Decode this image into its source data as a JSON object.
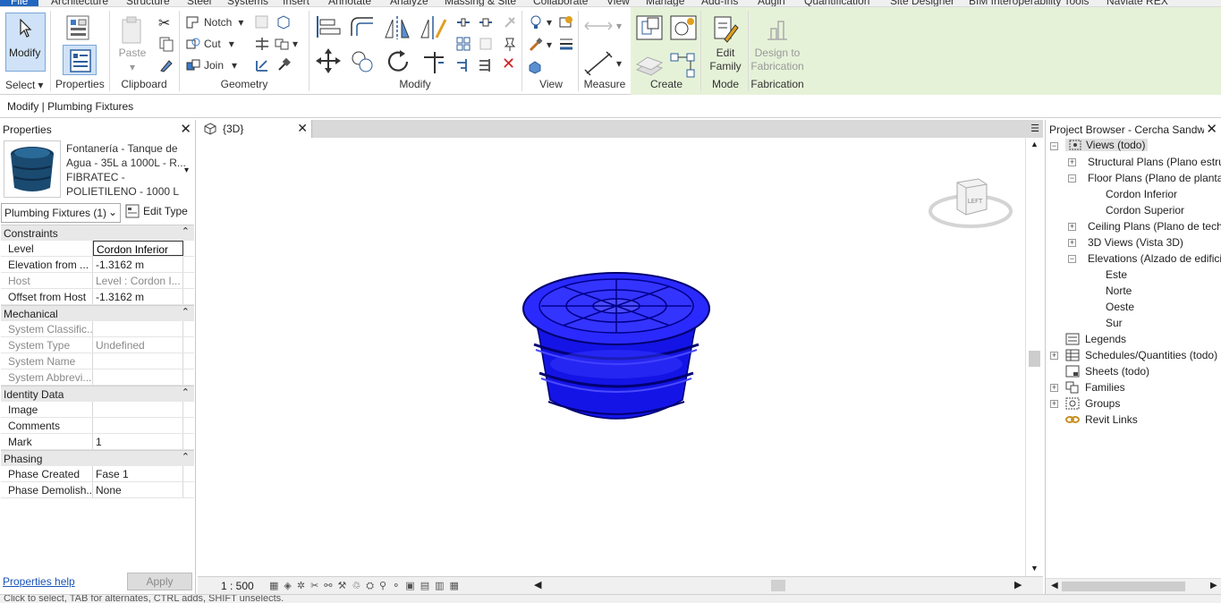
{
  "menu_tabs": [
    "File",
    "Architecture",
    "Structure",
    "Steel",
    "Systems",
    "Insert",
    "Annotate",
    "Analyze",
    "Massing & Site",
    "Collaborate",
    "View",
    "Manage",
    "Add-Ins",
    "Augin",
    "Quantification",
    "Site Designer",
    "BIM Interoperability Tools",
    "Naviate REX"
  ],
  "ribbon": {
    "modify_label": "Modify",
    "select_label": "Select",
    "properties_label": "Properties",
    "paste_label": "Paste",
    "clipboard_label": "Clipboard",
    "notch_label": "Notch",
    "cut_label": "Cut",
    "join_label": "Join",
    "geometry_label": "Geometry",
    "modify_group_label": "Modify",
    "view_label": "View",
    "measure_label": "Measure",
    "create_label": "Create",
    "edit_family_line1": "Edit",
    "edit_family_line2": "Family",
    "mode_label": "Mode",
    "design_fab_line1": "Design to",
    "design_fab_line2": "Fabrication",
    "fabrication_label": "Fabrication",
    "context_color": "#e6f2d8"
  },
  "options_bar": {
    "context": "Modify | Plumbing Fixtures"
  },
  "properties": {
    "title": "Properties",
    "type_name": "Fontanería - Tanque de Agua - 35L a 1000L - R... FIBRATEC - POLIETILENO - 1000 L",
    "type_dropdown": "Plumbing Fixtures (1)",
    "edit_type": "Edit Type",
    "categories": {
      "constraints": "Constraints",
      "mechanical": "Mechanical",
      "identity": "Identity Data",
      "phasing": "Phasing"
    },
    "rows": {
      "level": {
        "k": "Level",
        "v": "Cordon Inferior"
      },
      "elevation": {
        "k": "Elevation from ...",
        "v": "-1.3162 m"
      },
      "host": {
        "k": "Host",
        "v": "Level : Cordon I..."
      },
      "offset": {
        "k": "Offset from Host",
        "v": "-1.3162 m"
      },
      "sys_class": {
        "k": "System Classific...",
        "v": ""
      },
      "sys_type": {
        "k": "System Type",
        "v": "Undefined"
      },
      "sys_name": {
        "k": "System Name",
        "v": ""
      },
      "sys_abbrev": {
        "k": "System Abbrevi...",
        "v": ""
      },
      "image": {
        "k": "Image",
        "v": ""
      },
      "comments": {
        "k": "Comments",
        "v": ""
      },
      "mark": {
        "k": "Mark",
        "v": "1"
      },
      "phase_created": {
        "k": "Phase Created",
        "v": "Fase 1"
      },
      "phase_demolished": {
        "k": "Phase Demolish...",
        "v": "None"
      }
    },
    "help_link": "Properties help",
    "apply_button": "Apply"
  },
  "view": {
    "tab_label": "{3D}",
    "scale": "1 : 500",
    "viewcube_face": "LEFT",
    "model_color": "#1a1aff"
  },
  "browser": {
    "title": "Project Browser - Cercha Sandwich",
    "views_root": "Views (todo)",
    "structural_plans": "Structural Plans (Plano estructural)",
    "floor_plans": "Floor Plans (Plano de planta)",
    "cordon_inferior": "Cordon Inferior",
    "cordon_superior": "Cordon Superior",
    "ceiling_plans": "Ceiling Plans (Plano de techo)",
    "views_3d": "3D Views (Vista 3D)",
    "elevations": "Elevations (Alzado de edificio)",
    "este": "Este",
    "norte": "Norte",
    "oeste": "Oeste",
    "sur": "Sur",
    "legends": "Legends",
    "schedules": "Schedules/Quantities (todo)",
    "sheets": "Sheets (todo)",
    "families": "Families",
    "groups": "Groups",
    "revit_links": "Revit Links"
  },
  "status_bar": {
    "text": "Click to select, TAB for alternates, CTRL adds, SHIFT unselects."
  }
}
